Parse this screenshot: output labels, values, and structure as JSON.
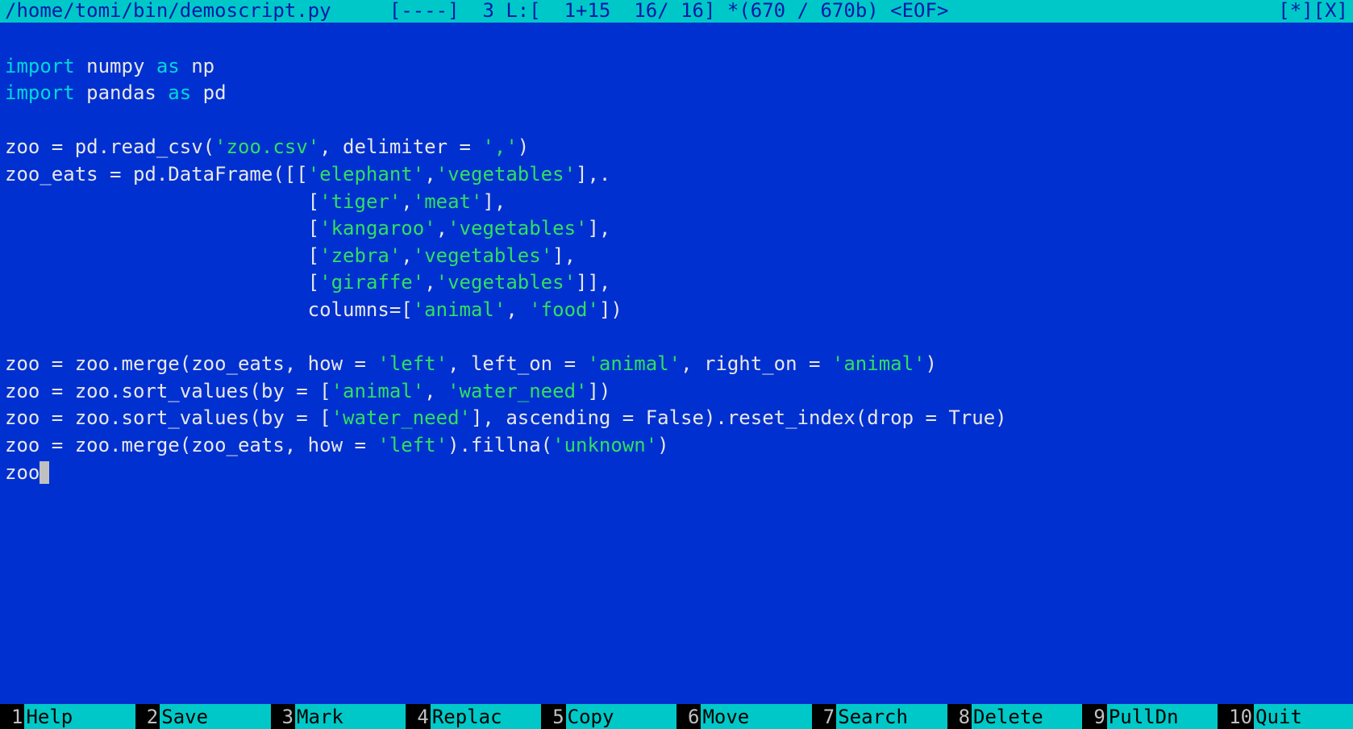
{
  "top": {
    "path": "/home/tomi/bin/demoscript.py",
    "flags": "[----]",
    "pos": "3 L:[  1+15  16/ 16] *(670 / 670b) <EOF>",
    "right": "[*][X]"
  },
  "code": {
    "l01a": "import",
    "l01b": " numpy ",
    "l01c": "as",
    "l01d": " np",
    "l02a": "import",
    "l02b": " pandas ",
    "l02c": "as",
    "l02d": " pd",
    "blank": "",
    "l04a": "zoo = pd.read_csv(",
    "l04s1": "'zoo.csv'",
    "l04b": ", delimiter = ",
    "l04s2": "','",
    "l04c": ")",
    "l05a": "zoo_eats = pd.DataFrame([[",
    "l05s1": "'elephant'",
    "l05b": ",",
    "l05s2": "'vegetables'",
    "l05c": "],.",
    "l06pad": "                          [",
    "l06s1": "'tiger'",
    "l06b": ",",
    "l06s2": "'meat'",
    "l06c": "],",
    "l07pad": "                          [",
    "l07s1": "'kangaroo'",
    "l07b": ",",
    "l07s2": "'vegetables'",
    "l07c": "],",
    "l08pad": "                          [",
    "l08s1": "'zebra'",
    "l08b": ",",
    "l08s2": "'vegetables'",
    "l08c": "],",
    "l09pad": "                          [",
    "l09s1": "'giraffe'",
    "l09b": ",",
    "l09s2": "'vegetables'",
    "l09c": "]],",
    "l10pad": "                          columns=[",
    "l10s1": "'animal'",
    "l10b": ", ",
    "l10s2": "'food'",
    "l10c": "])",
    "l12a": "zoo = zoo.merge(zoo_eats, how = ",
    "l12s1": "'left'",
    "l12b": ", left_on = ",
    "l12s2": "'animal'",
    "l12c": ", right_on = ",
    "l12s3": "'animal'",
    "l12d": ")",
    "l13a": "zoo = zoo.sort_values(by = [",
    "l13s1": "'animal'",
    "l13b": ", ",
    "l13s2": "'water_need'",
    "l13c": "])",
    "l14a": "zoo = zoo.sort_values(by = [",
    "l14s1": "'water_need'",
    "l14b": "], ascending = False).reset_index(drop = True)",
    "l15a": "zoo = zoo.merge(zoo_eats, how = ",
    "l15s1": "'left'",
    "l15b": ").fillna(",
    "l15s2": "'unknown'",
    "l15c": ")",
    "l16a": "zoo"
  },
  "fnkeys": [
    {
      "num": "1",
      "label": "Help"
    },
    {
      "num": "2",
      "label": "Save"
    },
    {
      "num": "3",
      "label": "Mark"
    },
    {
      "num": "4",
      "label": "Replac"
    },
    {
      "num": "5",
      "label": "Copy"
    },
    {
      "num": "6",
      "label": "Move"
    },
    {
      "num": "7",
      "label": "Search"
    },
    {
      "num": "8",
      "label": "Delete"
    },
    {
      "num": "9",
      "label": "PullDn"
    },
    {
      "num": "10",
      "label": "Quit"
    }
  ]
}
